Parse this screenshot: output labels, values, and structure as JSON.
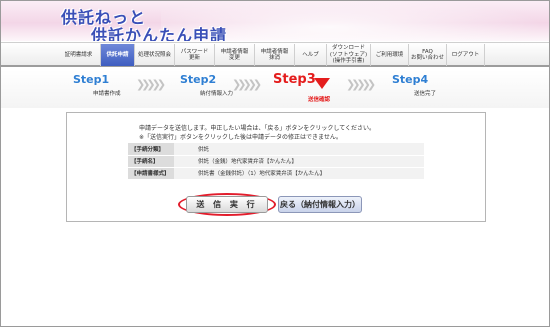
{
  "header": {
    "logo_line1": "供託ねっと",
    "logo_line2": "供託かんたん申請"
  },
  "nav": {
    "items": [
      {
        "label": "証明書請求",
        "active": false
      },
      {
        "label": "供託申請",
        "active": true
      },
      {
        "label": "処理状況照会",
        "active": false
      },
      {
        "label": "パスワード\n更新",
        "active": false
      },
      {
        "label": "申請者情報\n変更",
        "active": false
      },
      {
        "label": "申請者情報\n抹消",
        "active": false
      },
      {
        "label": "ヘルプ",
        "active": false
      },
      {
        "label": "ダウンロード\n(ソフトウェア)\n(操作手引書)",
        "active": false
      },
      {
        "label": "ご利用環境",
        "active": false
      },
      {
        "label": "FAQ\nお問い合わせ",
        "active": false
      },
      {
        "label": "ログアウト",
        "active": false
      }
    ]
  },
  "steps": [
    {
      "title": "Step1",
      "sub": "申請書作成"
    },
    {
      "title": "Step2",
      "sub": "納付情報入力"
    },
    {
      "title": "Step3",
      "sub": "送信確認"
    },
    {
      "title": "Step4",
      "sub": "送信完了"
    }
  ],
  "content": {
    "message_line1": "申請データを送信します。申正したい場合は、「戻る」ボタンをクリックしてください。",
    "message_line2": "※「送信実行」ボタンをクリックした後は申請データの修正はできません。",
    "info": [
      {
        "key": "【手続分類】",
        "value": "供託"
      },
      {
        "key": "【手続名】",
        "value": "供託（金銭）地代家賃弁済【かんたん】"
      },
      {
        "key": "【申請書様式】",
        "value": "供託書（金銭供託）（1）地代家賃弁済【かんたん】"
      }
    ],
    "send_button": "送 信 実 行",
    "back_button": "戻る（納付情報入力）"
  },
  "colors": {
    "brand_blue": "#3a4fb7",
    "step_blue": "#2f7fd3",
    "step_current_red": "#e41d1d",
    "highlight_red": "#e21d2c"
  }
}
